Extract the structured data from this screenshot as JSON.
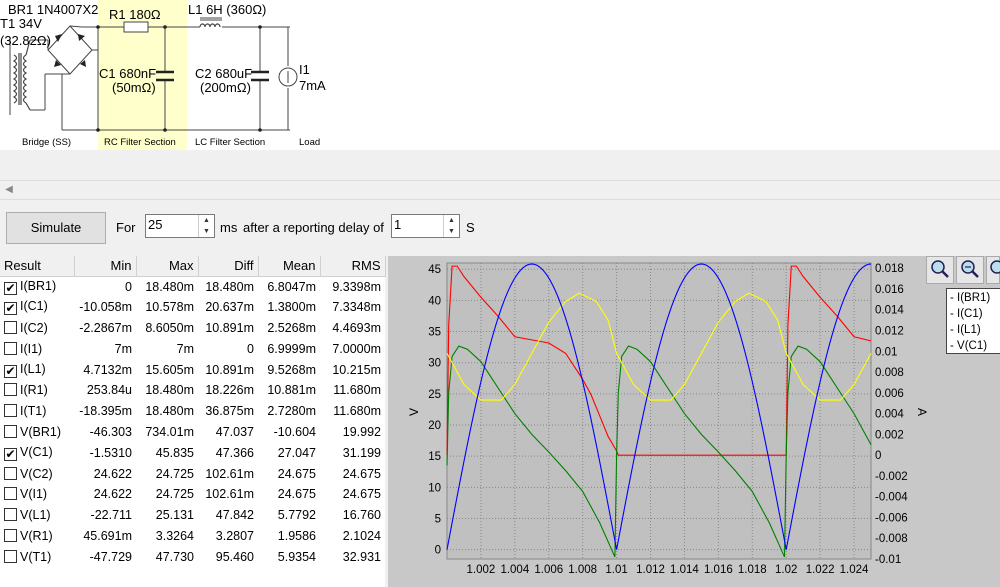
{
  "schematic": {
    "bridge_name": "BR1 1N4007X2",
    "transformer_name": "T1 34V",
    "transformer_res": "(32.82Ω)",
    "r1": "R1 180Ω",
    "l1": "L1 6H (360Ω)",
    "c1_name": "C1 680nF",
    "c1_esr": "(50mΩ)",
    "c2_name": "C2 680uF",
    "c2_esr": "(200mΩ)",
    "i1_name": "I1",
    "i1_val": "7mA",
    "sections": [
      "Bridge (SS)",
      "RC Filter Section",
      "LC Filter Section",
      "Load"
    ]
  },
  "controls": {
    "simulate": "Simulate",
    "for_label": "For",
    "duration_value": "25",
    "ms_label": "ms",
    "delay_label": "after a reporting delay of",
    "delay_value": "1",
    "s_label": "S"
  },
  "table": {
    "headers": [
      "Result",
      "Min",
      "Max",
      "Diff",
      "Mean",
      "RMS"
    ],
    "rows": [
      {
        "name": "I(BR1)",
        "checked": true,
        "min": "0",
        "max": "18.480m",
        "diff": "18.480m",
        "mean": "6.8047m",
        "rms": "9.3398m"
      },
      {
        "name": "I(C1)",
        "checked": true,
        "min": "-10.058m",
        "max": "10.578m",
        "diff": "20.637m",
        "mean": "1.3800m",
        "rms": "7.3348m"
      },
      {
        "name": "I(C2)",
        "checked": false,
        "min": "-2.2867m",
        "max": "8.6050m",
        "diff": "10.891m",
        "mean": "2.5268m",
        "rms": "4.4693m"
      },
      {
        "name": "I(I1)",
        "checked": false,
        "min": "7m",
        "max": "7m",
        "diff": "0",
        "mean": "6.9999m",
        "rms": "7.0000m"
      },
      {
        "name": "I(L1)",
        "checked": true,
        "min": "4.7132m",
        "max": "15.605m",
        "diff": "10.891m",
        "mean": "9.5268m",
        "rms": "10.215m"
      },
      {
        "name": "I(R1)",
        "checked": false,
        "min": "253.84u",
        "max": "18.480m",
        "diff": "18.226m",
        "mean": "10.881m",
        "rms": "11.680m"
      },
      {
        "name": "I(T1)",
        "checked": false,
        "min": "-18.395m",
        "max": "18.480m",
        "diff": "36.875m",
        "mean": "2.7280m",
        "rms": "11.680m"
      },
      {
        "name": "V(BR1)",
        "checked": false,
        "min": "-46.303",
        "max": "734.01m",
        "diff": "47.037",
        "mean": "-10.604",
        "rms": "19.992"
      },
      {
        "name": "V(C1)",
        "checked": true,
        "min": "-1.5310",
        "max": "45.835",
        "diff": "47.366",
        "mean": "27.047",
        "rms": "31.199"
      },
      {
        "name": "V(C2)",
        "checked": false,
        "min": "24.622",
        "max": "24.725",
        "diff": "102.61m",
        "mean": "24.675",
        "rms": "24.675"
      },
      {
        "name": "V(I1)",
        "checked": false,
        "min": "24.622",
        "max": "24.725",
        "diff": "102.61m",
        "mean": "24.675",
        "rms": "24.675"
      },
      {
        "name": "V(L1)",
        "checked": false,
        "min": "-22.711",
        "max": "25.131",
        "diff": "47.842",
        "mean": "5.7792",
        "rms": "16.760"
      },
      {
        "name": "V(R1)",
        "checked": false,
        "min": "45.691m",
        "max": "3.3264",
        "diff": "3.2807",
        "mean": "1.9586",
        "rms": "2.1024"
      },
      {
        "name": "V(T1)",
        "checked": false,
        "min": "-47.729",
        "max": "47.730",
        "diff": "95.460",
        "mean": "5.9354",
        "rms": "32.931"
      }
    ]
  },
  "plot": {
    "zoom_in_icon": "zoom-in-icon",
    "zoom_out_icon": "zoom-out-icon",
    "zoom_fit_icon": "zoom-fit-icon"
  },
  "chart_data": {
    "type": "line",
    "xlabel": "",
    "ylabel": "V",
    "y2label": "A",
    "xlim": [
      1.0,
      1.025
    ],
    "ylim": [
      -1.5,
      46
    ],
    "y2lim": [
      -0.01,
      0.0185
    ],
    "x_ticks": [
      "1.002",
      "1.004",
      "1.006",
      "1.008",
      "1.01",
      "1.012",
      "1.014",
      "1.016",
      "1.018",
      "1.02",
      "1.022",
      "1.024"
    ],
    "y_ticks": [
      "0",
      "5",
      "10",
      "15",
      "20",
      "25",
      "30",
      "35",
      "40",
      "45"
    ],
    "y2_ticks": [
      "-0.01",
      "-0.008",
      "-0.006",
      "-0.004",
      "-0.002",
      "0",
      "0.002",
      "0.004",
      "0.006",
      "0.008",
      "0.01",
      "0.012",
      "0.014",
      "0.016",
      "0.018"
    ],
    "legend_position": "top-right",
    "series": [
      {
        "name": "I(BR1)",
        "color": "#ff0000",
        "axis": "right",
        "x": [
          1.0,
          1.0001,
          1.0003,
          1.0006,
          1.001,
          1.002,
          1.003,
          1.004,
          1.005,
          1.006,
          1.007,
          1.008,
          1.0085,
          1.009,
          1.0095,
          1.01,
          1.0101,
          1.011,
          1.012,
          1.013,
          1.014,
          1.015,
          1.016,
          1.017,
          1.018,
          1.019,
          1.02,
          1.0201,
          1.0203,
          1.0206,
          1.021,
          1.022,
          1.023,
          1.024,
          1.025
        ],
        "y": [
          0.0,
          0.0125,
          0.0182,
          0.0182,
          0.0172,
          0.0152,
          0.0134,
          0.0114,
          0.0111,
          0.0108,
          0.0098,
          0.0073,
          0.0058,
          0.0038,
          0.0018,
          0.0004,
          0.0,
          0.0,
          0.0,
          0.0,
          0.0,
          0.0,
          0.0,
          0.0,
          0.0,
          0.0,
          0.0,
          0.0125,
          0.0182,
          0.0182,
          0.0172,
          0.0152,
          0.0134,
          0.0114,
          0.011
        ]
      },
      {
        "name": "I(C1)",
        "color": "#008000",
        "axis": "right",
        "x": [
          1.0,
          1.0001,
          1.0003,
          1.0007,
          1.0012,
          1.002,
          1.003,
          1.004,
          1.005,
          1.006,
          1.007,
          1.008,
          1.009,
          1.0099,
          1.01,
          1.0101,
          1.0103,
          1.0107,
          1.0112,
          1.012,
          1.013,
          1.014,
          1.015,
          1.016,
          1.017,
          1.018,
          1.019,
          1.0199,
          1.02,
          1.0201,
          1.0203,
          1.0207,
          1.0212,
          1.022,
          1.023,
          1.024,
          1.025
        ],
        "y": [
          -0.001,
          0.006,
          0.0095,
          0.0105,
          0.0102,
          0.009,
          0.0065,
          0.004,
          0.002,
          0.0003,
          -0.0015,
          -0.0035,
          -0.0065,
          -0.0098,
          0.0,
          0.006,
          0.0095,
          0.0105,
          0.0102,
          0.009,
          0.0065,
          0.004,
          0.002,
          0.0003,
          -0.0015,
          -0.0035,
          -0.0065,
          -0.0098,
          0.0,
          0.006,
          0.0095,
          0.0105,
          0.0102,
          0.009,
          0.0065,
          0.004,
          0.001
        ]
      },
      {
        "name": "I(L1)",
        "color": "#ffff00",
        "axis": "right",
        "x": [
          1.0,
          1.001,
          1.002,
          1.0032,
          1.004,
          1.005,
          1.006,
          1.007,
          1.0078,
          1.0088,
          1.0095,
          1.01,
          1.011,
          1.012,
          1.0132,
          1.014,
          1.015,
          1.016,
          1.017,
          1.0178,
          1.0188,
          1.0195,
          1.02,
          1.021,
          1.022,
          1.0232,
          1.024,
          1.025
        ],
        "y": [
          0.0098,
          0.0068,
          0.0053,
          0.0053,
          0.0068,
          0.0098,
          0.0128,
          0.0148,
          0.0156,
          0.0148,
          0.013,
          0.0098,
          0.0068,
          0.0053,
          0.0053,
          0.0068,
          0.0098,
          0.0128,
          0.0148,
          0.0156,
          0.0148,
          0.013,
          0.0098,
          0.0068,
          0.0053,
          0.0053,
          0.0068,
          0.0098
        ]
      },
      {
        "name": "V(C1)",
        "color": "#0000ff",
        "axis": "left",
        "fn": "45.835*|sin(pi*(x-1)/0.01)|",
        "x": [
          1.0,
          1.001,
          1.002,
          1.003,
          1.004,
          1.005,
          1.006,
          1.007,
          1.008,
          1.009,
          1.01,
          1.011,
          1.012,
          1.013,
          1.014,
          1.015,
          1.016,
          1.017,
          1.018,
          1.019,
          1.02,
          1.021,
          1.022,
          1.023,
          1.024,
          1.025
        ],
        "y": [
          0.0,
          14.2,
          26.9,
          37.1,
          43.6,
          45.8,
          43.6,
          37.1,
          26.9,
          14.2,
          0.0,
          14.2,
          26.9,
          37.1,
          43.6,
          45.8,
          43.6,
          37.1,
          26.9,
          14.2,
          0.0,
          14.2,
          26.9,
          37.1,
          43.6,
          45.8
        ]
      }
    ]
  }
}
